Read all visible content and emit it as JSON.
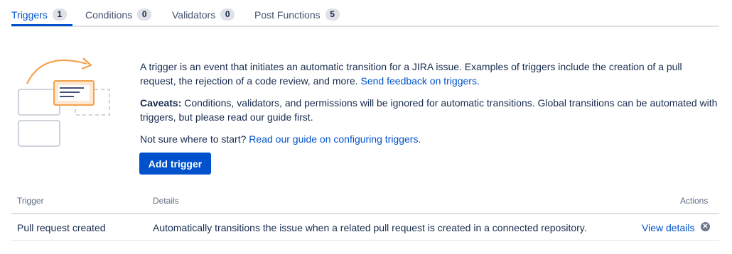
{
  "tabs": [
    {
      "label": "Triggers",
      "count": "1"
    },
    {
      "label": "Conditions",
      "count": "0"
    },
    {
      "label": "Validators",
      "count": "0"
    },
    {
      "label": "Post Functions",
      "count": "5"
    }
  ],
  "intro": {
    "text": "A trigger is an event that initiates an automatic transition for a JIRA issue. Examples of triggers include the creation of a pull request, the rejection of a code review, and more.",
    "feedback_link": "Send feedback on triggers.",
    "caveats_label": "Caveats:",
    "caveats_text": "Conditions, validators, and permissions will be ignored for automatic transitions. Global transitions can be automated with triggers, but please read our guide first.",
    "start_text": "Not sure where to start?",
    "guide_link": "Read our guide on configuring triggers."
  },
  "add_button": "Add trigger",
  "table": {
    "headers": {
      "trigger": "Trigger",
      "details": "Details",
      "actions": "Actions"
    },
    "rows": [
      {
        "trigger": "Pull request created",
        "details": "Automatically transitions the issue when a related pull request is created in a connected repository.",
        "action": "View details"
      }
    ]
  },
  "colors": {
    "accent": "#0052cc",
    "illustration_orange": "#f4a14b"
  }
}
